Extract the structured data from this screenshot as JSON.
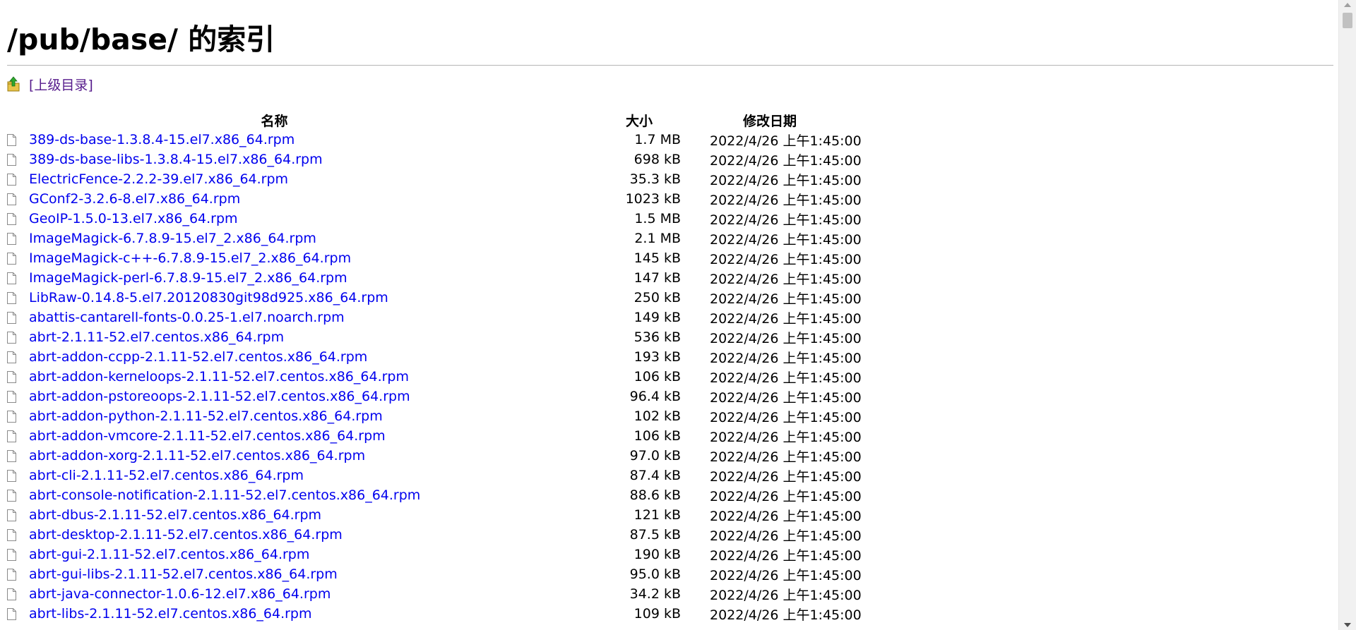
{
  "header": {
    "title": "/pub/base/ 的索引"
  },
  "parent": {
    "label": "[上级目录]",
    "icon": "folder-up-icon"
  },
  "table": {
    "columns": [
      "名称",
      "大小",
      "修改日期"
    ],
    "rows": [
      {
        "name": "389-ds-base-1.3.8.4-15.el7.x86_64.rpm",
        "size": "1.7 MB",
        "date": "2022/4/26 上午1:45:00"
      },
      {
        "name": "389-ds-base-libs-1.3.8.4-15.el7.x86_64.rpm",
        "size": "698 kB",
        "date": "2022/4/26 上午1:45:00"
      },
      {
        "name": "ElectricFence-2.2.2-39.el7.x86_64.rpm",
        "size": "35.3 kB",
        "date": "2022/4/26 上午1:45:00"
      },
      {
        "name": "GConf2-3.2.6-8.el7.x86_64.rpm",
        "size": "1023 kB",
        "date": "2022/4/26 上午1:45:00"
      },
      {
        "name": "GeoIP-1.5.0-13.el7.x86_64.rpm",
        "size": "1.5 MB",
        "date": "2022/4/26 上午1:45:00"
      },
      {
        "name": "ImageMagick-6.7.8.9-15.el7_2.x86_64.rpm",
        "size": "2.1 MB",
        "date": "2022/4/26 上午1:45:00"
      },
      {
        "name": "ImageMagick-c++-6.7.8.9-15.el7_2.x86_64.rpm",
        "size": "145 kB",
        "date": "2022/4/26 上午1:45:00"
      },
      {
        "name": "ImageMagick-perl-6.7.8.9-15.el7_2.x86_64.rpm",
        "size": "147 kB",
        "date": "2022/4/26 上午1:45:00"
      },
      {
        "name": "LibRaw-0.14.8-5.el7.20120830git98d925.x86_64.rpm",
        "size": "250 kB",
        "date": "2022/4/26 上午1:45:00"
      },
      {
        "name": "abattis-cantarell-fonts-0.0.25-1.el7.noarch.rpm",
        "size": "149 kB",
        "date": "2022/4/26 上午1:45:00"
      },
      {
        "name": "abrt-2.1.11-52.el7.centos.x86_64.rpm",
        "size": "536 kB",
        "date": "2022/4/26 上午1:45:00"
      },
      {
        "name": "abrt-addon-ccpp-2.1.11-52.el7.centos.x86_64.rpm",
        "size": "193 kB",
        "date": "2022/4/26 上午1:45:00"
      },
      {
        "name": "abrt-addon-kerneloops-2.1.11-52.el7.centos.x86_64.rpm",
        "size": "106 kB",
        "date": "2022/4/26 上午1:45:00"
      },
      {
        "name": "abrt-addon-pstoreoops-2.1.11-52.el7.centos.x86_64.rpm",
        "size": "96.4 kB",
        "date": "2022/4/26 上午1:45:00"
      },
      {
        "name": "abrt-addon-python-2.1.11-52.el7.centos.x86_64.rpm",
        "size": "102 kB",
        "date": "2022/4/26 上午1:45:00"
      },
      {
        "name": "abrt-addon-vmcore-2.1.11-52.el7.centos.x86_64.rpm",
        "size": "106 kB",
        "date": "2022/4/26 上午1:45:00"
      },
      {
        "name": "abrt-addon-xorg-2.1.11-52.el7.centos.x86_64.rpm",
        "size": "97.0 kB",
        "date": "2022/4/26 上午1:45:00"
      },
      {
        "name": "abrt-cli-2.1.11-52.el7.centos.x86_64.rpm",
        "size": "87.4 kB",
        "date": "2022/4/26 上午1:45:00"
      },
      {
        "name": "abrt-console-notification-2.1.11-52.el7.centos.x86_64.rpm",
        "size": "88.6 kB",
        "date": "2022/4/26 上午1:45:00"
      },
      {
        "name": "abrt-dbus-2.1.11-52.el7.centos.x86_64.rpm",
        "size": "121 kB",
        "date": "2022/4/26 上午1:45:00"
      },
      {
        "name": "abrt-desktop-2.1.11-52.el7.centos.x86_64.rpm",
        "size": "87.5 kB",
        "date": "2022/4/26 上午1:45:00"
      },
      {
        "name": "abrt-gui-2.1.11-52.el7.centos.x86_64.rpm",
        "size": "190 kB",
        "date": "2022/4/26 上午1:45:00"
      },
      {
        "name": "abrt-gui-libs-2.1.11-52.el7.centos.x86_64.rpm",
        "size": "95.0 kB",
        "date": "2022/4/26 上午1:45:00"
      },
      {
        "name": "abrt-java-connector-1.0.6-12.el7.x86_64.rpm",
        "size": "34.2 kB",
        "date": "2022/4/26 上午1:45:00"
      },
      {
        "name": "abrt-libs-2.1.11-52.el7.centos.x86_64.rpm",
        "size": "109 kB",
        "date": "2022/4/26 上午1:45:00"
      }
    ]
  }
}
